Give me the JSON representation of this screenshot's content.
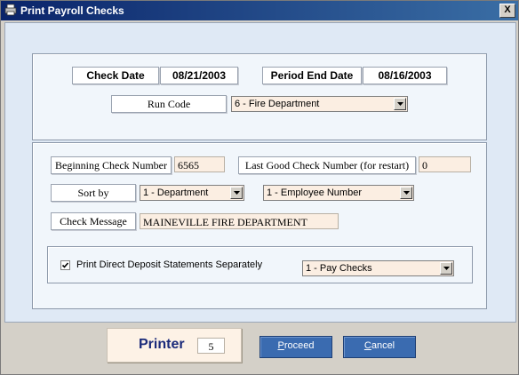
{
  "window": {
    "title": "Print Payroll Checks",
    "close_label": "X"
  },
  "header": {
    "check_date_label": "Check Date",
    "check_date_value": "08/21/2003",
    "period_end_label": "Period End Date",
    "period_end_value": "08/16/2003",
    "run_code_label": "Run Code",
    "run_code_value": "6 - Fire Department"
  },
  "options": {
    "beginning_check_label": "Beginning Check Number",
    "beginning_check_value": "6565",
    "last_good_label": "Last Good Check Number (for restart)",
    "last_good_value": "0",
    "sort_by_label": "Sort by",
    "sort_primary": "1 - Department",
    "sort_secondary": "1 - Employee Number",
    "check_message_label": "Check Message",
    "check_message_value": "MAINEVILLE FIRE DEPARTMENT",
    "direct_deposit_label": "Print Direct Deposit Statements Separately",
    "direct_deposit_checked": true,
    "direct_deposit_mode": "1 - Pay Checks"
  },
  "footer": {
    "printer_label": "Printer",
    "printer_value": "5",
    "proceed_prefix": "P",
    "proceed_rest": "roceed",
    "cancel_prefix": "C",
    "cancel_rest": "ancel"
  }
}
